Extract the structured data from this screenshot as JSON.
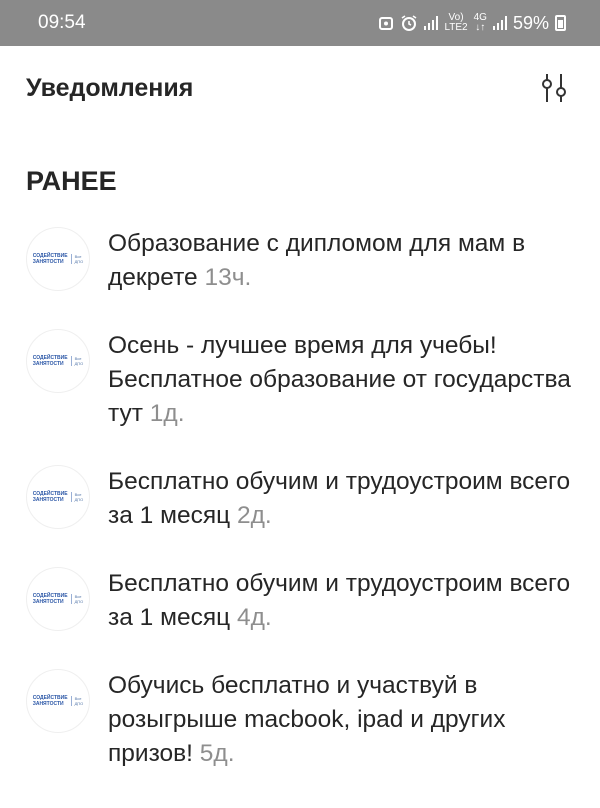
{
  "status_bar": {
    "time": "09:54",
    "network_top": "Vo)",
    "network_bottom": "LTE2",
    "data_top": "4G",
    "data_bottom": "↓↑",
    "battery": "59%"
  },
  "header": {
    "title": "Уведомления"
  },
  "section": {
    "title": "РАНЕЕ"
  },
  "logo": {
    "line1": "СОДЕЙСТВИЕ",
    "line2": "ЗАНЯТОСТИ",
    "sub1": "Все",
    "sub2": "ДПО"
  },
  "notifications": [
    {
      "text": "Образование с дипломом для мам в декрете",
      "time": "13ч."
    },
    {
      "text": "Осень - лучшее время для учебы! Бесплатное образование от государства тут",
      "time": "1д."
    },
    {
      "text": "Бесплатно обучим и трудоустроим всего за 1 месяц",
      "time": "2д."
    },
    {
      "text": "Бесплатно обучим и трудоустроим всего за 1 месяц",
      "time": "4д."
    },
    {
      "text": "Обучись бесплатно и участвуй в розыгрыше macbook, ipad и других призов!",
      "time": "5д."
    }
  ]
}
